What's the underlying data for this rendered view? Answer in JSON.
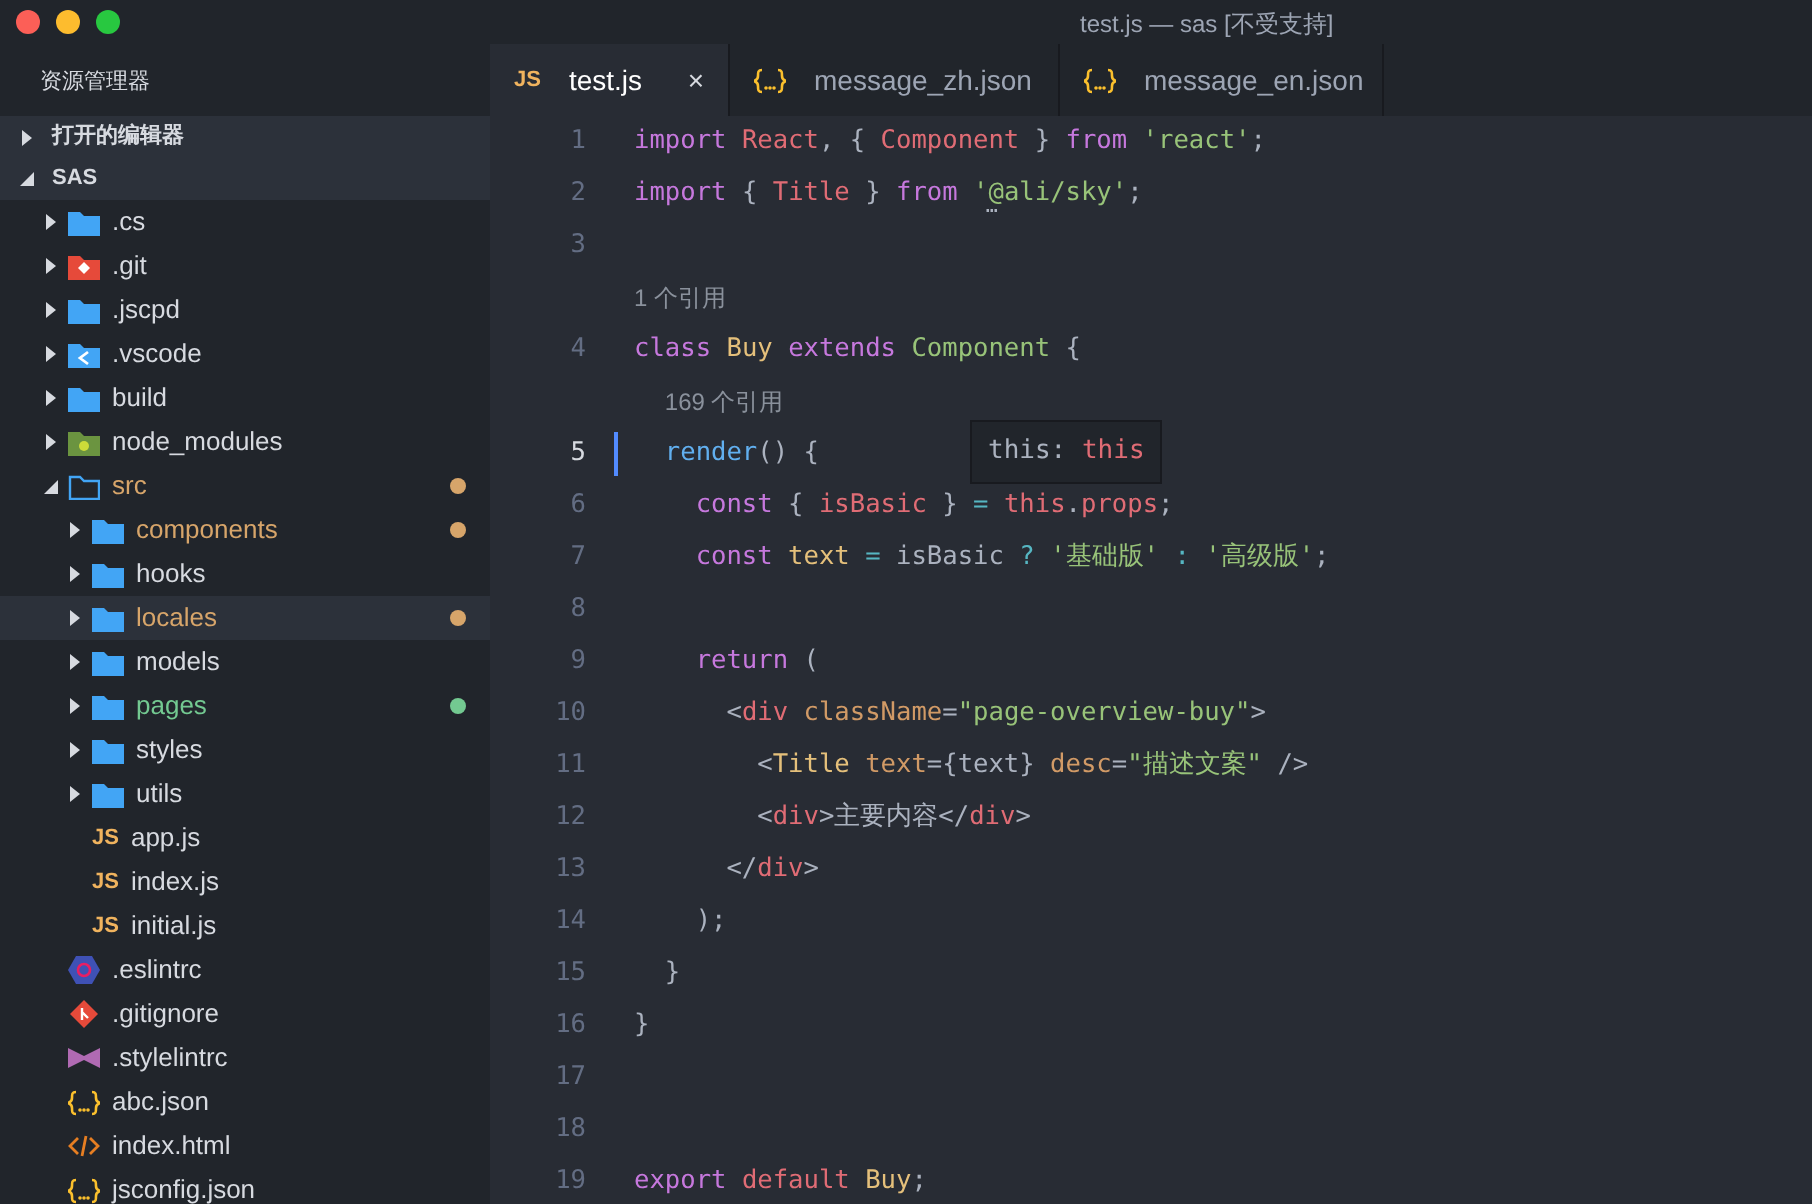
{
  "window": {
    "title": "test.js — sas [不受支持]"
  },
  "sidebar": {
    "title": "资源管理器",
    "sections": [
      {
        "label": "打开的编辑器",
        "expanded": false
      },
      {
        "label": "SAS",
        "expanded": true,
        "items": [
          {
            "name": ".cs",
            "kind": "folder",
            "expanded": false,
            "selected": false
          },
          {
            "name": ".git",
            "kind": "folder-git",
            "expanded": false,
            "selected": false
          },
          {
            "name": ".jscpd",
            "kind": "folder",
            "expanded": false,
            "selected": false
          },
          {
            "name": ".vscode",
            "kind": "folder-vscode",
            "expanded": false,
            "selected": false
          },
          {
            "name": "build",
            "kind": "folder",
            "expanded": false,
            "selected": false
          },
          {
            "name": "node_modules",
            "kind": "folder-node",
            "expanded": false,
            "selected": false
          },
          {
            "name": "src",
            "kind": "folder",
            "expanded": true,
            "selected": false,
            "color": "#d7a56a",
            "children": [
              {
                "name": "components",
                "kind": "folder",
                "expanded": false,
                "selected": false,
                "color": "#d7a56a"
              },
              {
                "name": "hooks",
                "kind": "folder",
                "expanded": false,
                "selected": false
              },
              {
                "name": "locales",
                "kind": "folder",
                "expanded": false,
                "selected": true,
                "color": "#d7a56a"
              },
              {
                "name": "models",
                "kind": "folder",
                "expanded": false,
                "selected": false
              },
              {
                "name": "pages",
                "kind": "folder",
                "expanded": false,
                "selected": false,
                "color": "#73c991"
              },
              {
                "name": "styles",
                "kind": "folder",
                "expanded": false,
                "selected": false
              },
              {
                "name": "utils",
                "kind": "folder",
                "expanded": false,
                "selected": false
              },
              {
                "name": "app.js",
                "kind": "js",
                "icon_label": "JS",
                "selected": false
              },
              {
                "name": "index.js",
                "kind": "js",
                "icon_label": "JS",
                "selected": false
              },
              {
                "name": "initial.js",
                "kind": "js",
                "icon_label": "JS",
                "selected": false
              }
            ]
          },
          {
            "name": ".eslintrc",
            "kind": "eslint",
            "selected": false
          },
          {
            "name": ".gitignore",
            "kind": "git",
            "selected": false
          },
          {
            "name": ".stylelintrc",
            "kind": "stylelint",
            "selected": false
          },
          {
            "name": "abc.json",
            "kind": "json",
            "selected": false
          },
          {
            "name": "index.html",
            "kind": "html",
            "selected": false
          },
          {
            "name": "jsconfig.json",
            "kind": "json",
            "selected": false
          }
        ]
      }
    ]
  },
  "tabs": [
    {
      "label": "test.js",
      "kind": "js",
      "icon_label": "JS",
      "selected": true,
      "close": "×"
    },
    {
      "label": "message_zh.json",
      "kind": "json",
      "selected": false
    },
    {
      "label": "message_en.json",
      "kind": "json",
      "selected": false
    }
  ],
  "editor": {
    "lines": [
      {
        "number": "1",
        "active": false,
        "tokens": [
          {
            "text": "import",
            "kind": "kw"
          },
          {
            "text": " React",
            "kind": "var"
          },
          {
            "text": ", { ",
            "kind": "plain"
          },
          {
            "text": "Component",
            "kind": "var"
          },
          {
            "text": " } ",
            "kind": "plain"
          },
          {
            "text": "from",
            "kind": "kw"
          },
          {
            "text": " 'react'",
            "kind": "str"
          },
          {
            "text": ";",
            "kind": "plain"
          }
        ]
      },
      {
        "number": "2",
        "active": false,
        "tokens": [
          {
            "text": "import",
            "kind": "kw"
          },
          {
            "text": " { ",
            "kind": "plain"
          },
          {
            "text": "Title",
            "kind": "var"
          },
          {
            "text": " } ",
            "kind": "plain"
          },
          {
            "text": "from",
            "kind": "kw"
          },
          {
            "text": " '@ali/sky'",
            "kind": "str",
            "hint": "…"
          },
          {
            "text": ";",
            "kind": "plain"
          }
        ]
      },
      {
        "number": "3",
        "active": false
      },
      {
        "number": "4",
        "active": false,
        "codelens": "1 个引用",
        "tokens": [
          {
            "text": "class",
            "kind": "kw"
          },
          {
            "text": " Buy",
            "kind": "cls"
          },
          {
            "text": " extends",
            "kind": "kw"
          },
          {
            "text": " Component",
            "kind": "str"
          },
          {
            "text": " {",
            "kind": "plain"
          }
        ]
      },
      {
        "number": "5",
        "active": true,
        "codelens": "169 个引用",
        "tokens": [
          {
            "text": "  render",
            "kind": "fn"
          },
          {
            "text": "() {",
            "kind": "plain"
          }
        ]
      },
      {
        "number": "6",
        "active": false,
        "tokens": [
          {
            "text": "    const",
            "kind": "kw"
          },
          {
            "text": " { ",
            "kind": "plain"
          },
          {
            "text": "isBasic",
            "kind": "var"
          },
          {
            "text": " } ",
            "kind": "plain"
          },
          {
            "text": "=",
            "kind": "op"
          },
          {
            "text": " this",
            "kind": "var"
          },
          {
            "text": ".",
            "kind": "plain"
          },
          {
            "text": "props",
            "kind": "var"
          },
          {
            "text": ";",
            "kind": "plain"
          }
        ]
      },
      {
        "number": "7",
        "active": false,
        "tokens": [
          {
            "text": "    const",
            "kind": "kw"
          },
          {
            "text": " text",
            "kind": "cls"
          },
          {
            "text": " =",
            "kind": "op"
          },
          {
            "text": " isBasic ",
            "kind": "plain"
          },
          {
            "text": "?",
            "kind": "op"
          },
          {
            "text": " '基础版'",
            "kind": "str"
          },
          {
            "text": " :",
            "kind": "op"
          },
          {
            "text": " '高级版'",
            "kind": "str"
          },
          {
            "text": ";",
            "kind": "plain"
          }
        ]
      },
      {
        "number": "8",
        "active": false
      },
      {
        "number": "9",
        "active": false,
        "tokens": [
          {
            "text": "    return",
            "kind": "kw"
          },
          {
            "text": " (",
            "kind": "plain"
          }
        ]
      },
      {
        "number": "10",
        "active": false,
        "tokens": [
          {
            "text": "      <",
            "kind": "plain"
          },
          {
            "text": "div",
            "kind": "var"
          },
          {
            "text": " className",
            "kind": "attr"
          },
          {
            "text": "=",
            "kind": "plain"
          },
          {
            "text": "\"page-overview-buy\"",
            "kind": "str"
          },
          {
            "text": ">",
            "kind": "plain"
          }
        ]
      },
      {
        "number": "11",
        "active": false,
        "tokens": [
          {
            "text": "        <",
            "kind": "plain"
          },
          {
            "text": "Title",
            "kind": "cls"
          },
          {
            "text": " text",
            "kind": "attr"
          },
          {
            "text": "={text}",
            "kind": "plain"
          },
          {
            "text": " desc",
            "kind": "attr"
          },
          {
            "text": "=",
            "kind": "plain"
          },
          {
            "text": "\"描述文案\"",
            "kind": "str"
          },
          {
            "text": " />",
            "kind": "plain"
          }
        ]
      },
      {
        "number": "12",
        "active": false,
        "tokens": [
          {
            "text": "        <",
            "kind": "plain"
          },
          {
            "text": "div",
            "kind": "var"
          },
          {
            "text": ">主要内容</",
            "kind": "plain"
          },
          {
            "text": "div",
            "kind": "var"
          },
          {
            "text": ">",
            "kind": "plain"
          }
        ]
      },
      {
        "number": "13",
        "active": false,
        "tokens": [
          {
            "text": "      </",
            "kind": "plain"
          },
          {
            "text": "div",
            "kind": "var"
          },
          {
            "text": ">",
            "kind": "plain"
          }
        ]
      },
      {
        "number": "14",
        "active": false,
        "tokens": [
          {
            "text": "    );",
            "kind": "plain"
          }
        ]
      },
      {
        "number": "15",
        "active": false,
        "tokens": [
          {
            "text": "  }",
            "kind": "plain"
          }
        ]
      },
      {
        "number": "16",
        "active": false,
        "tokens": [
          {
            "text": "}",
            "kind": "plain"
          }
        ]
      },
      {
        "number": "17",
        "active": false
      },
      {
        "number": "18",
        "active": false
      },
      {
        "number": "19",
        "active": false,
        "tokens": [
          {
            "text": "export",
            "kind": "kw"
          },
          {
            "text": " default",
            "kind": "var"
          },
          {
            "text": " Buy",
            "kind": "cls"
          },
          {
            "text": ";",
            "kind": "plain"
          }
        ]
      }
    ],
    "hover": {
      "label": "this: ",
      "value": "this"
    }
  }
}
